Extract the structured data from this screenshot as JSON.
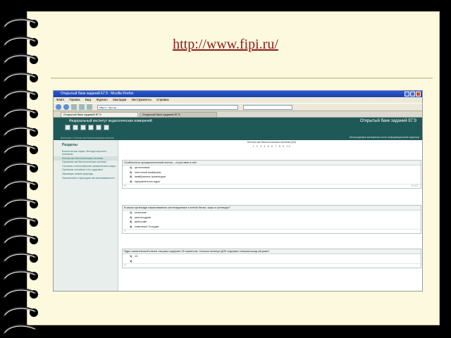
{
  "slide": {
    "url_title": "http://www.fipi.ru/"
  },
  "browser": {
    "window_title": "Открытый банк заданий ЕГЭ - Mozilla Firefox",
    "menu": [
      "Файл",
      "Правка",
      "Вид",
      "Журнал",
      "Закладки",
      "Инструменты",
      "Справка"
    ],
    "address": "http://...fipi.ru/...",
    "tabs": [
      "Открытый банк заданий ЕГЭ",
      "Открытый банк заданий ЕГЭ"
    ]
  },
  "site": {
    "org_name": "Федеральный институт педагогических измерений",
    "bank_title": "Открытый банк заданий ЕГЭ",
    "subtitle": "Используемые материалы носят информационный характер",
    "breadcrumb": "Биология > Клетка как биологическая система"
  },
  "sidebar": {
    "heading": "Разделы",
    "items": [
      "Биология как наука. Методы научного познания",
      "Клетка как биологическая система",
      "Организм как биологическая система",
      "Система и многообразие органического мира",
      "Организм человека и его здоровье",
      "Эволюция живой природы",
      "Экосистемы и присущие им закономерности"
    ]
  },
  "main": {
    "caption": "Клетка как биологическая система (62)",
    "pager": "1 2 3 4 5 6 7 8 9 10",
    "questions": [
      {
        "text": "Особенность прокариотической клетки – отсутствие в ней",
        "options": [
          {
            "num": "1)",
            "text": "цитоплазмы"
          },
          {
            "num": "2)",
            "text": "клеточной мембраны"
          },
          {
            "num": "3)",
            "text": "мембранных органоидов"
          },
          {
            "num": "4)",
            "text": "оформленного ядра"
          }
        ],
        "code": "1F1C7"
      },
      {
        "text": "В каком органоиде накапливаются синтезируемые в клетке белки, жиры и углеводы?",
        "options": [
          {
            "num": "1)",
            "text": "лизосоме"
          },
          {
            "num": "2)",
            "text": "митохондрии"
          },
          {
            "num": "3)",
            "text": "рибосоме"
          },
          {
            "num": "4)",
            "text": "комплексе Гольджи"
          }
        ],
        "code": ""
      },
      {
        "text": "Ядро соматической клетки лягушки содержит 26 хромосом. Сколько молекул ДНК содержит сперматозоид лягушки?",
        "options": [
          {
            "num": "1)",
            "text": "13"
          },
          {
            "num": "2)",
            "text": ""
          }
        ],
        "code": ""
      }
    ]
  }
}
